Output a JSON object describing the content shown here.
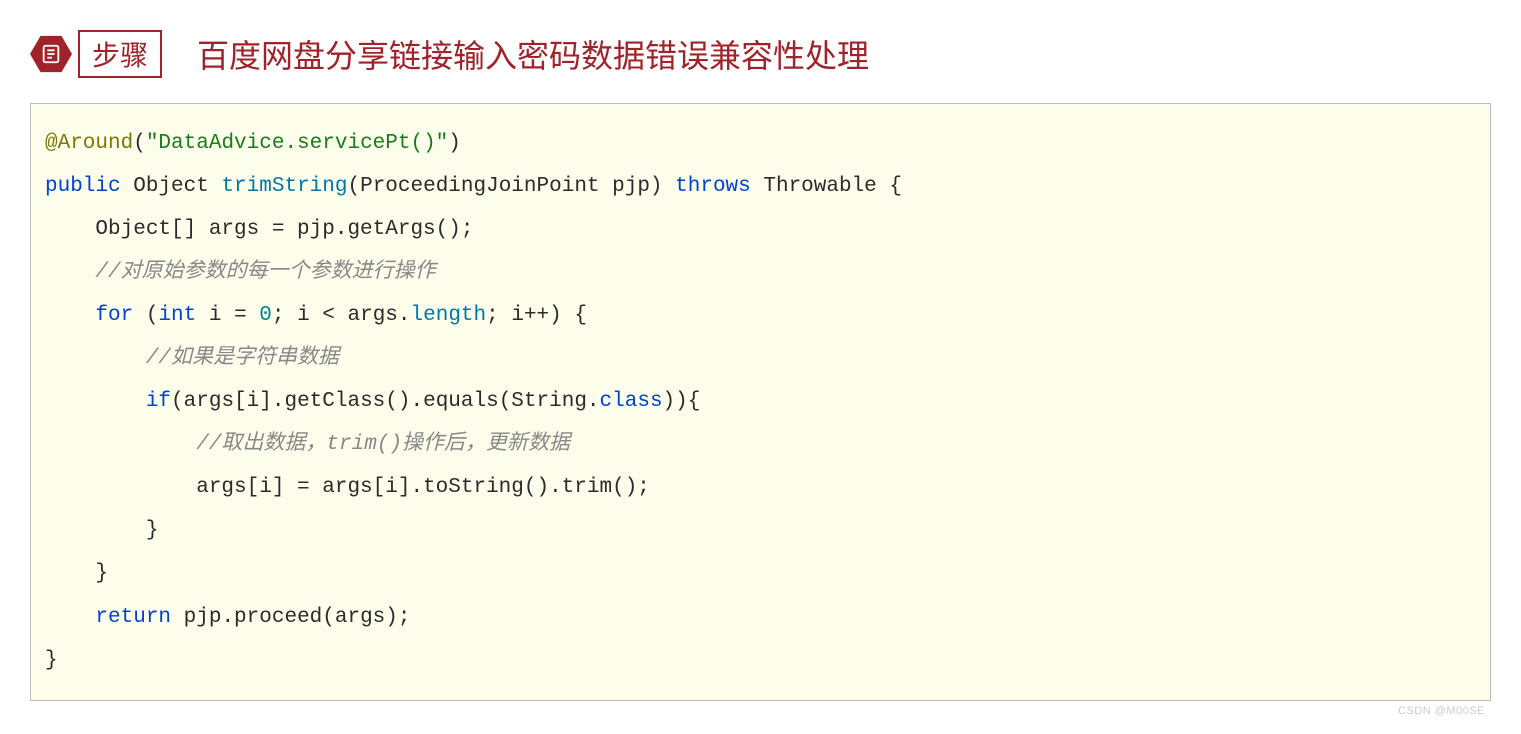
{
  "header": {
    "step_label": "步骤",
    "title": "百度网盘分享链接输入密码数据错误兼容性处理"
  },
  "code": {
    "annotation_prefix": "@Around",
    "annotation_arg": "\"DataAdvice.servicePt()\"",
    "kw_public": "public",
    "type_object": "Object ",
    "fn_trimString": "trimString",
    "sig_rest": "(ProceedingJoinPoint pjp) ",
    "kw_throws": "throws",
    "throws_rest": " Throwable {",
    "line_args": "    Object[] args = pjp.getArgs();",
    "comment1": "    //对原始参数的每一个参数进行操作",
    "kw_for": "for",
    "kw_int": "int",
    "num_zero": "0",
    "prop_length": "length",
    "for_open_a": " (",
    "for_after_int": " i = ",
    "for_mid": "; i < args.",
    "for_end": "; i++) {",
    "comment2": "        //如果是字符串数据",
    "kw_if": "if",
    "if_open": "(args[i].getClass().equals(String.",
    "kw_class": "class",
    "if_close": ")){",
    "comment3": "            //取出数据，trim()操作后，更新数据",
    "line_assign": "            args[i] = args[i].toString().trim();",
    "brace_close3": "        }",
    "brace_close2": "    }",
    "kw_return": "return",
    "return_rest": " pjp.proceed(args);",
    "brace_close1": "}"
  },
  "watermark": "CSDN @M00SE"
}
